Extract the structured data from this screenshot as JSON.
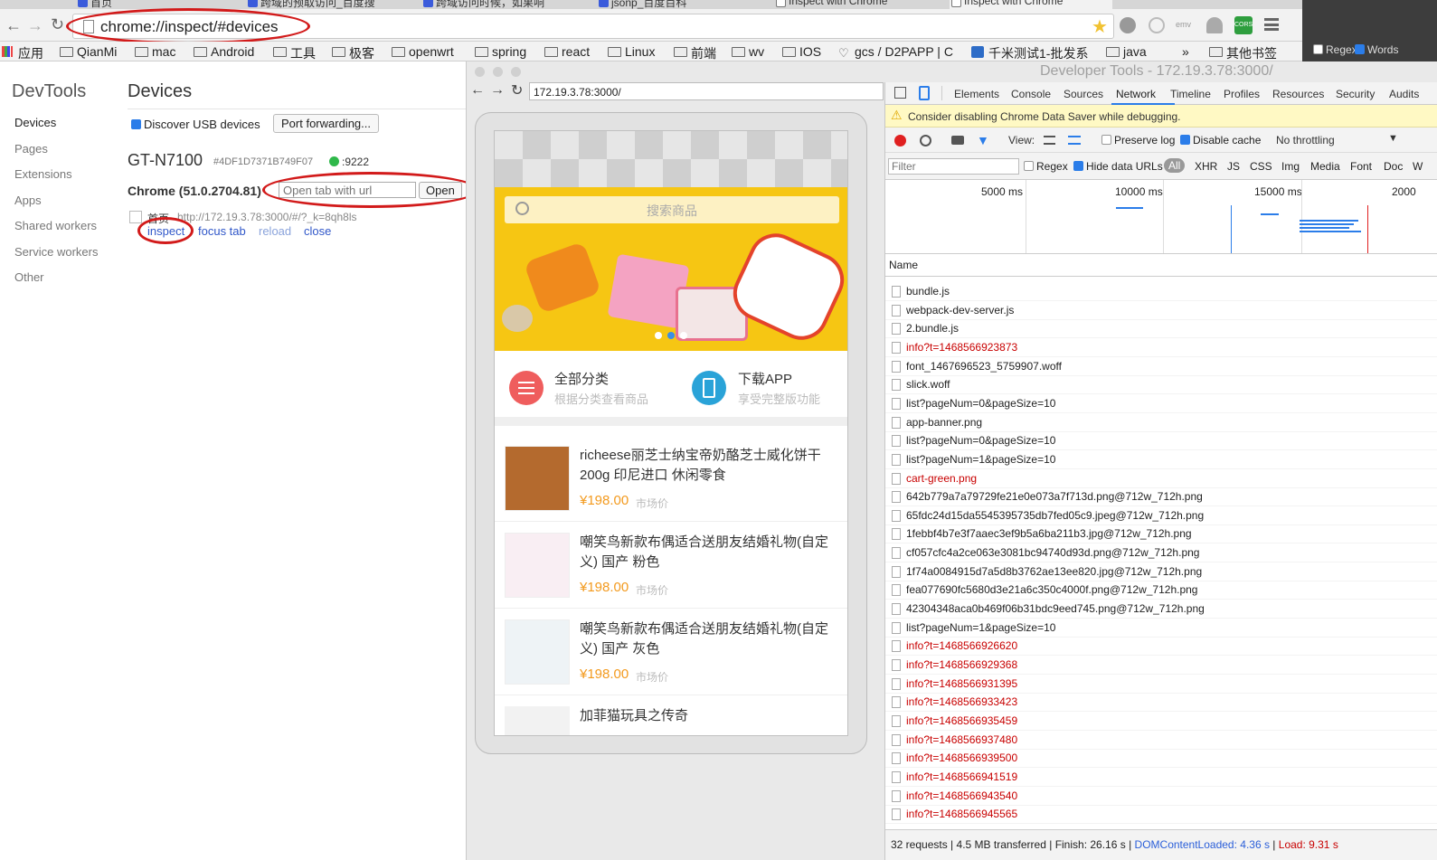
{
  "browser": {
    "tabs": [
      "首页",
      "跨域的预取访问_百度搜",
      "跨域访问时候，如果响",
      "jsonp_百度百科",
      "Inspect with Chrome",
      "Inspect with Chrome"
    ],
    "address": "chrome://inspect/#devices",
    "bookmarks": [
      "应用",
      "QianMi",
      "mac",
      "Android",
      "工具",
      "极客",
      "openwrt",
      "spring",
      "react",
      "Linux",
      "前端",
      "wv",
      "IOS",
      "gcs / D2PAPP | C",
      "千米测试1-批发系",
      "java"
    ],
    "bookmarks_more": "»",
    "other_bookmarks": "其他书签",
    "right_toggles": [
      "Regex",
      "Words"
    ]
  },
  "inspect": {
    "title": "DevTools",
    "nav": [
      "Devices",
      "Pages",
      "Extensions",
      "Apps",
      "Shared workers",
      "Service workers",
      "Other"
    ],
    "heading": "Devices",
    "discover_usb": "Discover USB devices",
    "port_forwarding": "Port forwarding...",
    "device_name": "GT-N7100",
    "device_serial": "#4DF1D7371B749F07",
    "device_port": ":9222",
    "browser_version": "Chrome (51.0.2704.81)",
    "open_tab_placeholder": "Open tab with url",
    "open_button": "Open",
    "page_title": "首页",
    "page_url": "http://172.19.3.78:3000/#/?_k=8qh8ls",
    "actions": [
      "inspect",
      "focus tab",
      "reload",
      "close"
    ]
  },
  "devtools_window": {
    "title": "Developer Tools - 172.19.3.78:3000/",
    "screencast_url": "172.19.3.78:3000/"
  },
  "phone_app": {
    "search_placeholder": "搜索商品",
    "categories": [
      {
        "title": "全部分类",
        "subtitle": "根据分类查看商品"
      },
      {
        "title": "下载APP",
        "subtitle": "享受完整版功能"
      }
    ],
    "products": [
      {
        "name": "richeese丽芝士纳宝帝奶酪芝士威化饼干200g 印尼进口 休闲零食",
        "price": "¥198.00",
        "tag": "市场价"
      },
      {
        "name": "嘲笑鸟新款布偶适合送朋友结婚礼物(自定义) 国产 粉色",
        "price": "¥198.00",
        "tag": "市场价"
      },
      {
        "name": "嘲笑鸟新款布偶适合送朋友结婚礼物(自定义) 国产 灰色",
        "price": "¥198.00",
        "tag": "市场价"
      },
      {
        "name": "加菲猫玩具之传奇",
        "price": "",
        "tag": ""
      }
    ]
  },
  "devtools": {
    "tabs": [
      "Elements",
      "Console",
      "Sources",
      "Network",
      "Timeline",
      "Profiles",
      "Resources",
      "Security",
      "Audits"
    ],
    "active_tab": "Network",
    "warning": "Consider disabling Chrome Data Saver while debugging.",
    "view_label": "View:",
    "preserve_log": "Preserve log",
    "disable_cache": "Disable cache",
    "throttling": "No throttling",
    "filter_placeholder": "Filter",
    "regex": "Regex",
    "hide_data_urls": "Hide data URLs",
    "filter_types": [
      "All",
      "XHR",
      "JS",
      "CSS",
      "Img",
      "Media",
      "Font",
      "Doc",
      "W"
    ],
    "timeline_ticks": [
      "5000 ms",
      "10000 ms",
      "15000 ms",
      "2000"
    ],
    "name_header": "Name",
    "requests": [
      {
        "name": "bundle.js",
        "error": false
      },
      {
        "name": "webpack-dev-server.js",
        "error": false
      },
      {
        "name": "2.bundle.js",
        "error": false
      },
      {
        "name": "info?t=1468566923873",
        "error": true
      },
      {
        "name": "font_1467696523_5759907.woff",
        "error": false
      },
      {
        "name": "slick.woff",
        "error": false
      },
      {
        "name": "list?pageNum=0&pageSize=10",
        "error": false
      },
      {
        "name": "app-banner.png",
        "error": false
      },
      {
        "name": "list?pageNum=0&pageSize=10",
        "error": false
      },
      {
        "name": "list?pageNum=1&pageSize=10",
        "error": false
      },
      {
        "name": "cart-green.png",
        "error": true
      },
      {
        "name": "642b779a7a79729fe21e0e073a7f713d.png@712w_712h.png",
        "error": false
      },
      {
        "name": "65fdc24d15da5545395735db7fed05c9.jpeg@712w_712h.png",
        "error": false
      },
      {
        "name": "1febbf4b7e3f7aaec3ef9b5a6ba211b3.jpg@712w_712h.png",
        "error": false
      },
      {
        "name": "cf057cfc4a2ce063e3081bc94740d93d.png@712w_712h.png",
        "error": false
      },
      {
        "name": "1f74a0084915d7a5d8b3762ae13ee820.jpg@712w_712h.png",
        "error": false
      },
      {
        "name": "fea077690fc5680d3e21a6c350c4000f.png@712w_712h.png",
        "error": false
      },
      {
        "name": "42304348aca0b469f06b31bdc9eed745.png@712w_712h.png",
        "error": false
      },
      {
        "name": "list?pageNum=1&pageSize=10",
        "error": false
      },
      {
        "name": "info?t=1468566926620",
        "error": true
      },
      {
        "name": "info?t=1468566929368",
        "error": true
      },
      {
        "name": "info?t=1468566931395",
        "error": true
      },
      {
        "name": "info?t=1468566933423",
        "error": true
      },
      {
        "name": "info?t=1468566935459",
        "error": true
      },
      {
        "name": "info?t=1468566937480",
        "error": true
      },
      {
        "name": "info?t=1468566939500",
        "error": true
      },
      {
        "name": "info?t=1468566941519",
        "error": true
      },
      {
        "name": "info?t=1468566943540",
        "error": true
      },
      {
        "name": "info?t=1468566945565",
        "error": true
      }
    ],
    "status": {
      "requests": "32 requests",
      "transferred": "4.5 MB transferred",
      "finish": "Finish: 26.16 s",
      "dcl": "DOMContentLoaded: 4.36 s",
      "load": "Load: 9.31 s"
    }
  },
  "colors": {
    "annotation": "#d21a1a",
    "accent": "#2b7de9",
    "error": "#c80000",
    "price": "#f39a1e"
  }
}
